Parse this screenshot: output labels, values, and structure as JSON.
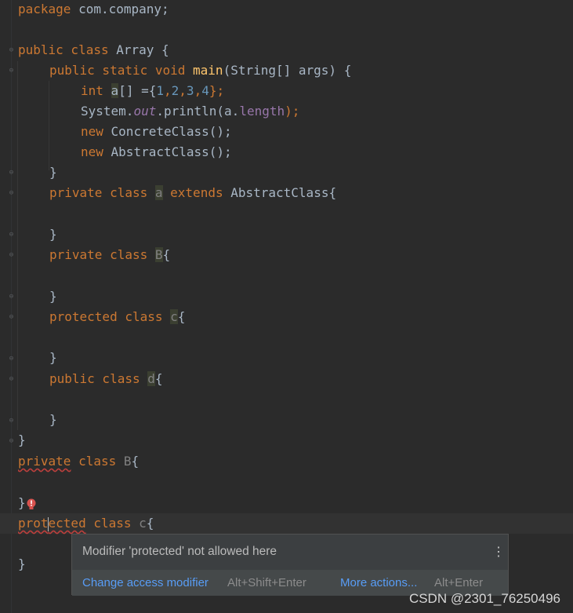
{
  "code": {
    "line1_package_kw": "package",
    "line1_rest": " com.company;",
    "class_decl": {
      "kw": "public class",
      "name": " Array {"
    },
    "main_decl": {
      "kw": "public static void",
      "name": "main",
      "args": "(String[] args) {"
    },
    "int_line": {
      "kw": "int",
      "var": "a",
      "rest": "[] ={",
      "n1": "1",
      "n2": "2",
      "n3": "3",
      "n4": "4",
      "end": "};"
    },
    "println_line": {
      "sys": "System.",
      "out": "out",
      "mid": ".println(a.",
      "len": "length",
      "end": ");"
    },
    "new_concrete": {
      "kw": "new",
      "rest": " ConcreteClass();"
    },
    "new_abstract": {
      "kw": "new",
      "rest": " AbstractClass();"
    },
    "close_brace": "}",
    "inner_a": {
      "kw": "private class",
      "name": "a",
      "ext": "extends",
      "rest": " AbstractClass{"
    },
    "inner_B": {
      "kw": "private class",
      "name": "B",
      "rest": "{"
    },
    "inner_c": {
      "kw": "protected class",
      "name": "c",
      "rest": "{"
    },
    "inner_d": {
      "kw": "public class",
      "name": "d",
      "rest": "{"
    },
    "outer_B": {
      "kw1": "private",
      "kw2": "class",
      "name": "B",
      "rest": "{"
    },
    "outer_c": {
      "kw1a": "prot",
      "kw1b": "ected",
      "kw2": "class",
      "name": "c",
      "rest": "{"
    }
  },
  "popup": {
    "message": "Modifier 'protected' not allowed here",
    "menu_icon": "⋮",
    "action1": "Change access modifier",
    "shortcut1": "Alt+Shift+Enter",
    "action2": "More actions...",
    "shortcut2": "Alt+Enter"
  },
  "watermark": "CSDN @2301_76250496",
  "colors": {
    "background": "#2b2b2b",
    "keyword": "#cc7832",
    "number": "#6897bb",
    "link": "#589df6",
    "error": "#bc3f3c"
  }
}
